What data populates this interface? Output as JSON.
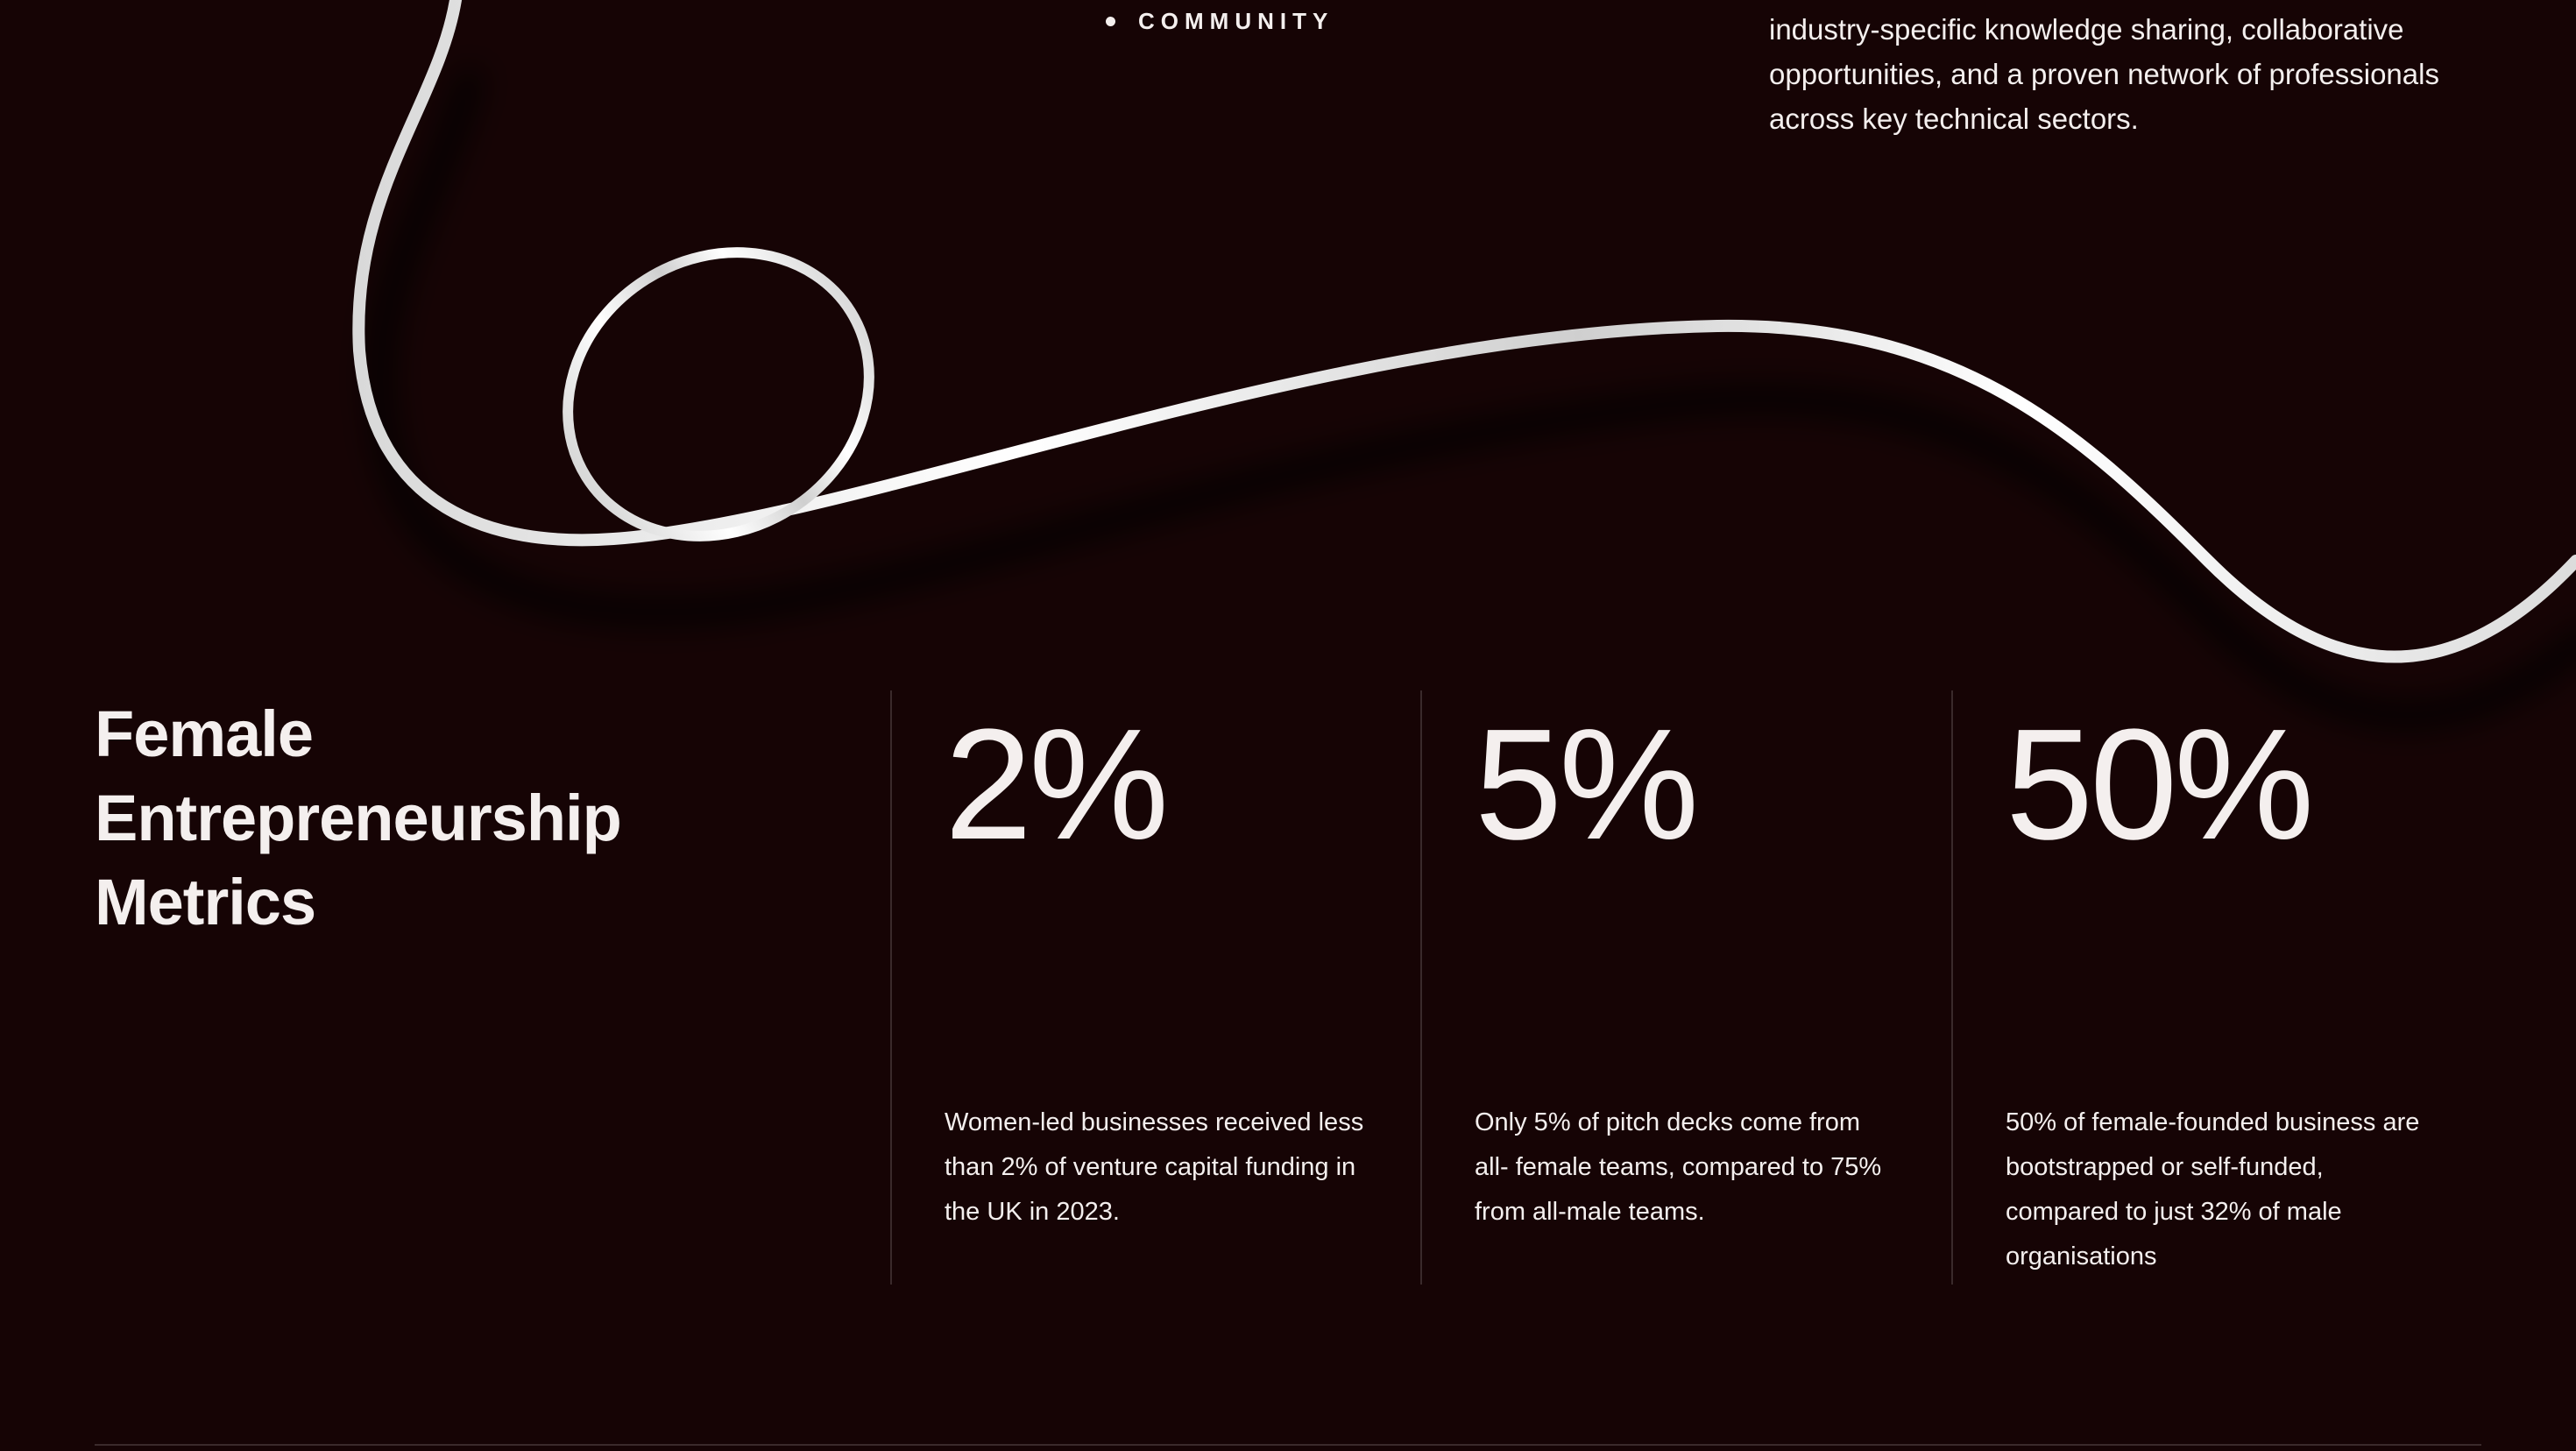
{
  "nav": {
    "community_label": "COMMUNITY"
  },
  "intro": {
    "lines": [
      "industry-specific knowledge sharing, collaborative",
      "opportunities, and a proven network of professionals",
      "across key technical sectors."
    ]
  },
  "metrics_section": {
    "title_lines": [
      "Female",
      "Entrepreneurship",
      "Metrics"
    ],
    "metrics": [
      {
        "value": "2%",
        "description_lines": [
          "Women-led businesses received less",
          "than 2% of venture capital funding in",
          "the UK in 2023."
        ]
      },
      {
        "value": "5%",
        "description_lines": [
          "Only 5% of pitch decks come from",
          "all- female teams, compared to 75%",
          "from all-male teams."
        ]
      },
      {
        "value": "50%",
        "description_lines": [
          "50% of female-founded business are",
          "bootstrapped or self-funded,",
          "compared to just 32% of male",
          "organisations"
        ]
      }
    ]
  },
  "colors": {
    "background": "#160405",
    "text": "#f4efee",
    "divider": "#3a2a2b",
    "ribbon": "#f2f2f2"
  },
  "decor": {
    "ribbon_name": "ribbon-graphic"
  }
}
